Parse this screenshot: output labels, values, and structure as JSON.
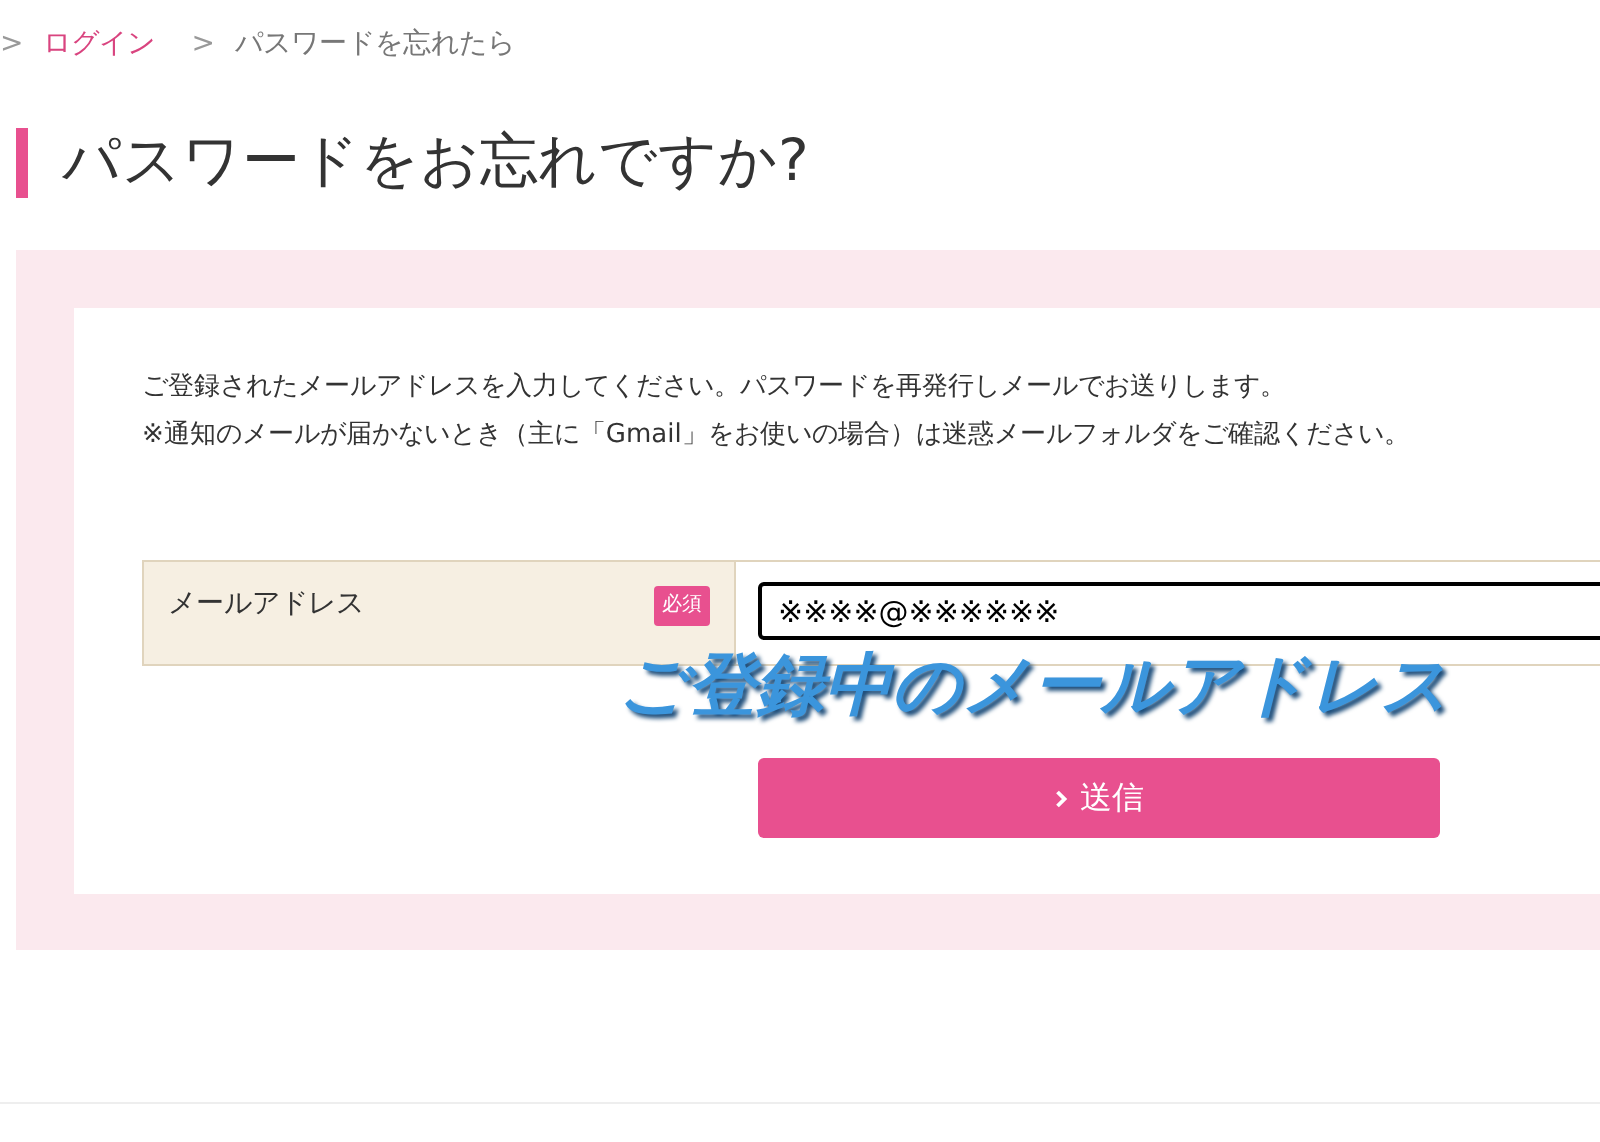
{
  "breadcrumb": [
    {
      "kind": "separator",
      "label": ">"
    },
    {
      "kind": "link",
      "label": "ログイン"
    },
    {
      "kind": "separator",
      "label": ">"
    },
    {
      "kind": "current",
      "label": "パスワードを忘れたら"
    }
  ],
  "title": "パスワードをお忘れですか?",
  "notes": [
    "ご登録されたメールアドレスを入力してください。パスワードを再発行しメールでお送りします。",
    "※通知のメールが届かないとき（主に「Gmail」をお使いの場合）は迷惑メールフォルダをご確認ください。"
  ],
  "form": {
    "label": "メールアドレス",
    "badge": "必須",
    "value": "※※※※@※※※※※※"
  },
  "annotation": "ご登録中のメールアドレス",
  "submit": {
    "label": "送信"
  }
}
